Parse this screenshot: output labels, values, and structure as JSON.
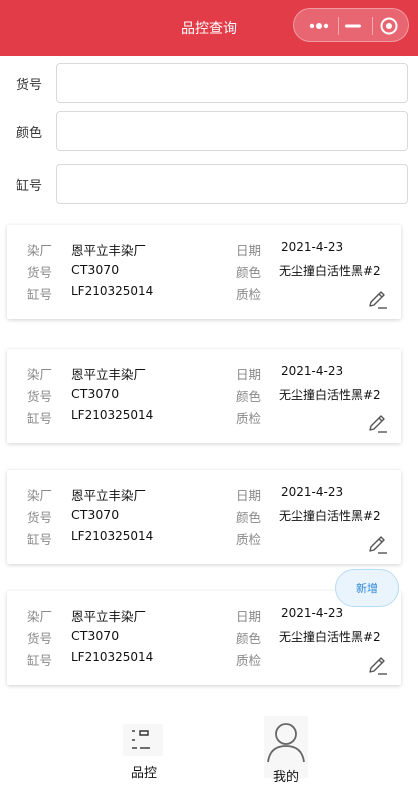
{
  "header": {
    "title": "品控查询"
  },
  "form": {
    "fields": [
      {
        "label": "货号",
        "value": ""
      },
      {
        "label": "颜色",
        "value": ""
      },
      {
        "label": "缸号",
        "value": ""
      }
    ]
  },
  "records": [
    {
      "dyehouse_label": "染厂",
      "dyehouse": "恩平立丰染厂",
      "item_label": "货号",
      "item": "CT3070",
      "vat_label": "缸号",
      "vat": "LF210325014",
      "date_label": "日期",
      "date": "2021-4-23",
      "color_label": "颜色",
      "color": "无尘撞白活性黑#2",
      "qc_label": "质检",
      "qc": ""
    },
    {
      "dyehouse_label": "染厂",
      "dyehouse": "恩平立丰染厂",
      "item_label": "货号",
      "item": "CT3070",
      "vat_label": "缸号",
      "vat": "LF210325014",
      "date_label": "日期",
      "date": "2021-4-23",
      "color_label": "颜色",
      "color": "无尘撞白活性黑#2",
      "qc_label": "质检",
      "qc": ""
    },
    {
      "dyehouse_label": "染厂",
      "dyehouse": "恩平立丰染厂",
      "item_label": "货号",
      "item": "CT3070",
      "vat_label": "缸号",
      "vat": "LF210325014",
      "date_label": "日期",
      "date": "2021-4-23",
      "color_label": "颜色",
      "color": "无尘撞白活性黑#2",
      "qc_label": "质检",
      "qc": ""
    },
    {
      "dyehouse_label": "染厂",
      "dyehouse": "恩平立丰染厂",
      "item_label": "货号",
      "item": "CT3070",
      "vat_label": "缸号",
      "vat": "LF210325014",
      "date_label": "日期",
      "date": "2021-4-23",
      "color_label": "颜色",
      "color": "无尘撞白活性黑#2",
      "qc_label": "质检",
      "qc": ""
    }
  ],
  "add_button": {
    "label": "新增"
  },
  "tabbar": {
    "tabs": [
      {
        "label": "品控",
        "icon": "list-icon"
      },
      {
        "label": "我的",
        "icon": "user-icon"
      }
    ]
  },
  "colors": {
    "header_bg": "#e23c49",
    "add_button_text": "#2f88d8",
    "add_button_bg": "#e9f4fd"
  }
}
